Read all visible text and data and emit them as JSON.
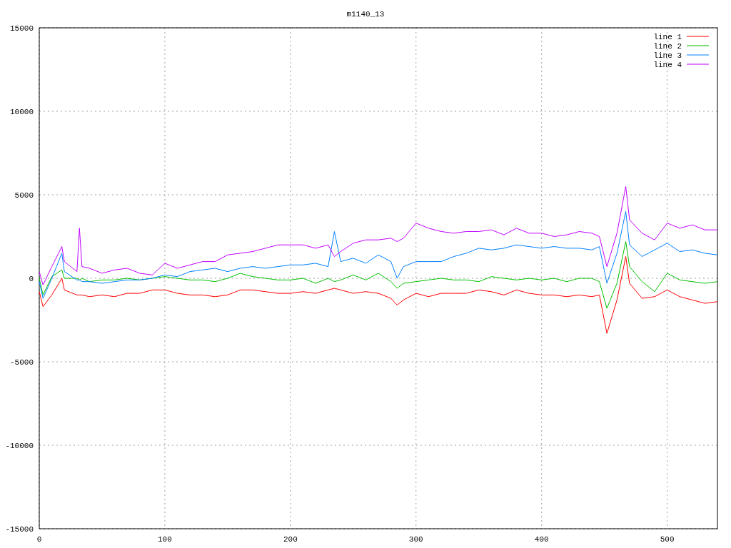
{
  "chart_data": {
    "type": "line",
    "title": "m1140_13",
    "x": [
      0,
      3,
      10,
      18,
      20,
      30,
      32,
      34,
      40,
      50,
      60,
      70,
      80,
      90,
      100,
      110,
      120,
      130,
      140,
      150,
      160,
      170,
      180,
      190,
      200,
      210,
      220,
      230,
      235,
      240,
      250,
      260,
      270,
      280,
      285,
      290,
      300,
      310,
      320,
      330,
      340,
      350,
      360,
      370,
      380,
      390,
      400,
      410,
      420,
      430,
      440,
      446,
      452,
      460,
      467,
      470,
      480,
      490,
      500,
      510,
      520,
      530,
      540
    ],
    "series": [
      {
        "name": "line 1",
        "color": "#ff0000",
        "values": [
          -800,
          -1700,
          -1000,
          0,
          -700,
          -1000,
          -1000,
          -1000,
          -1100,
          -1000,
          -1100,
          -900,
          -900,
          -700,
          -700,
          -900,
          -1000,
          -1000,
          -1100,
          -1000,
          -700,
          -700,
          -800,
          -900,
          -900,
          -800,
          -900,
          -700,
          -600,
          -700,
          -900,
          -800,
          -900,
          -1200,
          -1600,
          -1300,
          -900,
          -1100,
          -900,
          -900,
          -900,
          -700,
          -800,
          -1000,
          -700,
          -900,
          -1000,
          -1000,
          -1100,
          -1000,
          -1100,
          -1000,
          -3300,
          -1300,
          1300,
          -300,
          -1200,
          -1100,
          -700,
          -1100,
          -1300,
          -1500,
          -1400
        ]
      },
      {
        "name": "line 2",
        "color": "#00c000",
        "values": [
          0,
          -1000,
          100,
          500,
          0,
          0,
          -100,
          0,
          -200,
          -100,
          -100,
          0,
          -100,
          0,
          100,
          0,
          -100,
          -100,
          -200,
          0,
          300,
          100,
          0,
          -100,
          -100,
          0,
          -300,
          0,
          -200,
          -100,
          200,
          -100,
          300,
          -200,
          -600,
          -300,
          -200,
          -100,
          0,
          -100,
          -100,
          -200,
          100,
          0,
          -100,
          0,
          -100,
          0,
          -200,
          0,
          0,
          -200,
          -1800,
          -300,
          2200,
          700,
          -200,
          -800,
          300,
          -100,
          -200,
          -300,
          -200
        ]
      },
      {
        "name": "line 3",
        "color": "#0080ff",
        "values": [
          -200,
          -1200,
          0,
          1500,
          400,
          -100,
          -100,
          -200,
          -200,
          -300,
          -200,
          -100,
          -100,
          0,
          200,
          100,
          400,
          500,
          600,
          400,
          600,
          700,
          600,
          700,
          800,
          800,
          900,
          700,
          2800,
          1000,
          1200,
          900,
          1400,
          1000,
          0,
          700,
          1000,
          1000,
          1000,
          1300,
          1500,
          1800,
          1700,
          1800,
          2000,
          1900,
          1800,
          1900,
          1800,
          1800,
          1700,
          1900,
          -300,
          1500,
          4000,
          2000,
          1300,
          1700,
          2100,
          1600,
          1700,
          1500,
          1400
        ]
      },
      {
        "name": "line 4",
        "color": "#c000ff",
        "values": [
          400,
          -400,
          700,
          1900,
          1000,
          400,
          3000,
          700,
          600,
          300,
          500,
          600,
          300,
          200,
          900,
          600,
          800,
          1000,
          1000,
          1400,
          1500,
          1600,
          1800,
          2000,
          2000,
          2000,
          1800,
          2000,
          1300,
          1600,
          2100,
          2300,
          2300,
          2400,
          2200,
          2400,
          3300,
          3000,
          2800,
          2700,
          2800,
          2800,
          2900,
          2600,
          3000,
          2700,
          2700,
          2500,
          2600,
          2800,
          2700,
          2500,
          700,
          2700,
          5500,
          3500,
          2700,
          2300,
          3300,
          3000,
          3200,
          2900,
          2900
        ]
      }
    ],
    "xlim": [
      0,
      540
    ],
    "ylim": [
      -15000,
      15000
    ],
    "xticks": [
      0,
      100,
      200,
      300,
      400,
      500
    ],
    "yticks": [
      -15000,
      -10000,
      -5000,
      0,
      5000,
      10000,
      15000
    ],
    "grid": true,
    "legend": true
  }
}
